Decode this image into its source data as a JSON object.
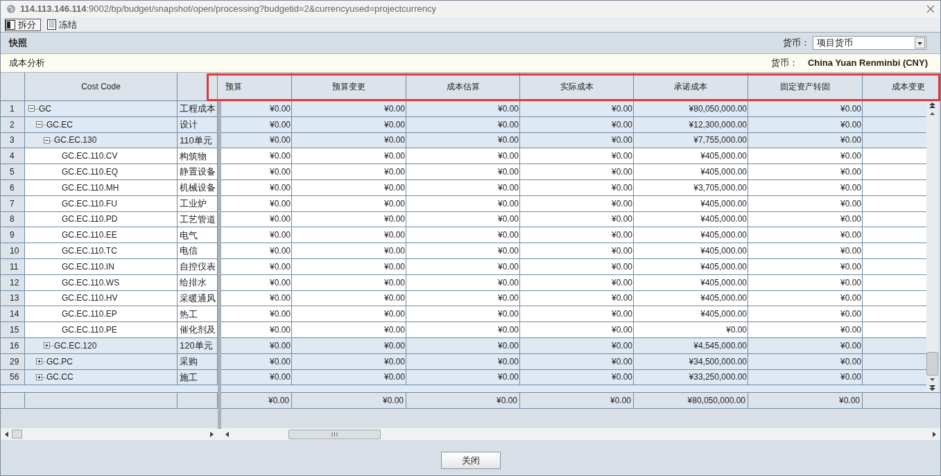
{
  "window": {
    "url": "**114.113.146.114**:9002/bp/budget/snapshot/open/processing?budgetid=2&currencyused=projectcurrency"
  },
  "toolbar": [
    {
      "label": "拆分",
      "selected": true
    },
    {
      "label": "冻结",
      "selected": false
    }
  ],
  "panel": {
    "title": "快照",
    "currency_label": "货币：",
    "currency_select": "项目货币"
  },
  "section": {
    "title": "成本分析",
    "currency_label": "货币：",
    "currency_value": "China Yuan Renminbi (CNY)"
  },
  "table": {
    "columns": [
      "Cost Code",
      "预算",
      "预算变更",
      "成本估算",
      "实际成本",
      "承诺成本",
      "固定资产转固",
      "成本变更"
    ],
    "rows": [
      {
        "num": "1",
        "code": "GC",
        "name": "工程成本",
        "expanded": true,
        "values": [
          "¥0.00",
          "¥0.00",
          "¥0.00",
          "¥0.00",
          "¥80,050,000.00",
          "¥0.00"
        ],
        "children": [
          {
            "num": "2",
            "code": "GC.EC",
            "name": "设计",
            "expanded": true,
            "values": [
              "¥0.00",
              "¥0.00",
              "¥0.00",
              "¥0.00",
              "¥12,300,000.00",
              "¥0.00"
            ],
            "children": [
              {
                "num": "3",
                "code": "GC.EC.130",
                "name": "110单元",
                "expanded": true,
                "values": [
                  "¥0.00",
                  "¥0.00",
                  "¥0.00",
                  "¥0.00",
                  "¥7,755,000.00",
                  "¥0.00"
                ],
                "children": [
                  {
                    "num": "4",
                    "code": "GC.EC.110.CV",
                    "name": "构筑物",
                    "values": [
                      "¥0.00",
                      "¥0.00",
                      "¥0.00",
                      "¥0.00",
                      "¥405,000.00",
                      "¥0.00"
                    ]
                  },
                  {
                    "num": "5",
                    "code": "GC.EC.110.EQ",
                    "name": "静置设备",
                    "values": [
                      "¥0.00",
                      "¥0.00",
                      "¥0.00",
                      "¥0.00",
                      "¥405,000.00",
                      "¥0.00"
                    ]
                  },
                  {
                    "num": "6",
                    "code": "GC.EC.110.MH",
                    "name": "机械设备",
                    "values": [
                      "¥0.00",
                      "¥0.00",
                      "¥0.00",
                      "¥0.00",
                      "¥3,705,000.00",
                      "¥0.00"
                    ]
                  },
                  {
                    "num": "7",
                    "code": "GC.EC.110.FU",
                    "name": "工业炉",
                    "values": [
                      "¥0.00",
                      "¥0.00",
                      "¥0.00",
                      "¥0.00",
                      "¥405,000.00",
                      "¥0.00"
                    ]
                  },
                  {
                    "num": "8",
                    "code": "GC.EC.110.PD",
                    "name": "工艺管道",
                    "values": [
                      "¥0.00",
                      "¥0.00",
                      "¥0.00",
                      "¥0.00",
                      "¥405,000.00",
                      "¥0.00"
                    ]
                  },
                  {
                    "num": "9",
                    "code": "GC.EC.110.EE",
                    "name": "电气",
                    "values": [
                      "¥0.00",
                      "¥0.00",
                      "¥0.00",
                      "¥0.00",
                      "¥405,000.00",
                      "¥0.00"
                    ]
                  },
                  {
                    "num": "10",
                    "code": "GC.EC.110.TC",
                    "name": "电信",
                    "values": [
                      "¥0.00",
                      "¥0.00",
                      "¥0.00",
                      "¥0.00",
                      "¥405,000.00",
                      "¥0.00"
                    ]
                  },
                  {
                    "num": "11",
                    "code": "GC.EC.110.IN",
                    "name": "自控仪表",
                    "values": [
                      "¥0.00",
                      "¥0.00",
                      "¥0.00",
                      "¥0.00",
                      "¥405,000.00",
                      "¥0.00"
                    ]
                  },
                  {
                    "num": "12",
                    "code": "GC.EC.110.WS",
                    "name": "给排水",
                    "values": [
                      "¥0.00",
                      "¥0.00",
                      "¥0.00",
                      "¥0.00",
                      "¥405,000.00",
                      "¥0.00"
                    ]
                  },
                  {
                    "num": "13",
                    "code": "GC.EC.110.HV",
                    "name": "采暖通风",
                    "values": [
                      "¥0.00",
                      "¥0.00",
                      "¥0.00",
                      "¥0.00",
                      "¥405,000.00",
                      "¥0.00"
                    ]
                  },
                  {
                    "num": "14",
                    "code": "GC.EC.110.EP",
                    "name": "热工",
                    "values": [
                      "¥0.00",
                      "¥0.00",
                      "¥0.00",
                      "¥0.00",
                      "¥405,000.00",
                      "¥0.00"
                    ]
                  },
                  {
                    "num": "15",
                    "code": "GC.EC.110.PE",
                    "name": "催化剂及",
                    "values": [
                      "¥0.00",
                      "¥0.00",
                      "¥0.00",
                      "¥0.00",
                      "¥0.00",
                      "¥0.00"
                    ]
                  }
                ]
              },
              {
                "num": "16",
                "code": "GC.EC.120",
                "name": "120单元",
                "expanded": false,
                "values": [
                  "¥0.00",
                  "¥0.00",
                  "¥0.00",
                  "¥0.00",
                  "¥4,545,000.00",
                  "¥0.00"
                ]
              }
            ]
          },
          {
            "num": "29",
            "code": "GC.PC",
            "name": "采购",
            "expanded": false,
            "values": [
              "¥0.00",
              "¥0.00",
              "¥0.00",
              "¥0.00",
              "¥34,500,000.00",
              "¥0.00"
            ]
          },
          {
            "num": "56",
            "code": "GC.CC",
            "name": "施工",
            "expanded": false,
            "values": [
              "¥0.00",
              "¥0.00",
              "¥0.00",
              "¥0.00",
              "¥33,250,000.00",
              "¥0.00"
            ]
          }
        ]
      }
    ],
    "totals": [
      "¥0.00",
      "¥0.00",
      "¥0.00",
      "¥0.00",
      "¥80,050,000.00",
      "¥0.00"
    ]
  },
  "buttons": [
    "关闭"
  ]
}
